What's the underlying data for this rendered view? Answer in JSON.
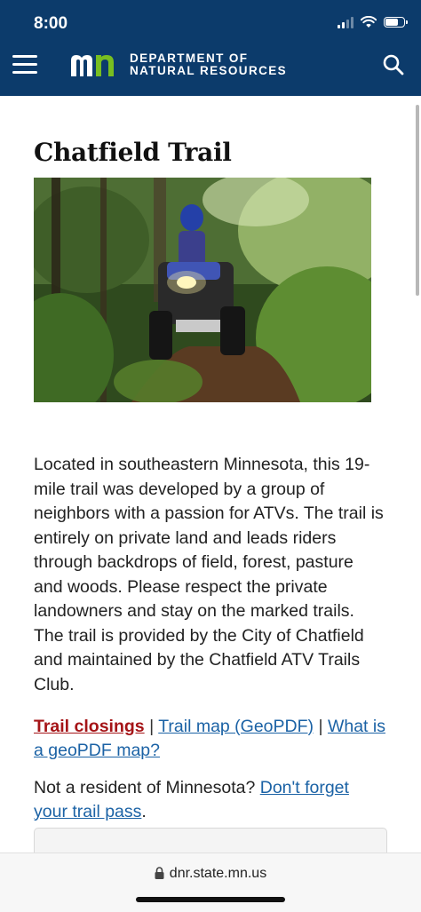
{
  "status_bar": {
    "time": "8:00"
  },
  "header": {
    "logo_line1": "Department of",
    "logo_line2": "Natural Resources",
    "brand_color": "#0c3b6b",
    "menu_icon": "hamburger-menu-icon",
    "search_icon": "search-icon"
  },
  "page": {
    "title": "Chatfield Trail",
    "hero_image_alt": "Rider on an ATV on a wooded trail",
    "intro": "Located in southeastern Minnesota, this 19-mile trail was developed by a group of neighbors with a passion for ATVs. The trail is entirely on private land and leads riders through backdrops of field, forest, pasture and woods. Please respect the private landowners and stay on the marked trails. The trail is provided by the City of Chatfield and maintained by the Chatfield ATV Trails Club.",
    "links": {
      "trail_closings": "Trail closings",
      "separator": "|",
      "trail_map": "Trail map (GeoPDF)",
      "what_is_geopdf": "What is a geoPDF map?"
    },
    "resident": {
      "prefix": "Not a resident of Minnesota?",
      "link": "Don't forget your trail pass",
      "suffix": "."
    }
  },
  "browser": {
    "url": "dnr.state.mn.us"
  }
}
